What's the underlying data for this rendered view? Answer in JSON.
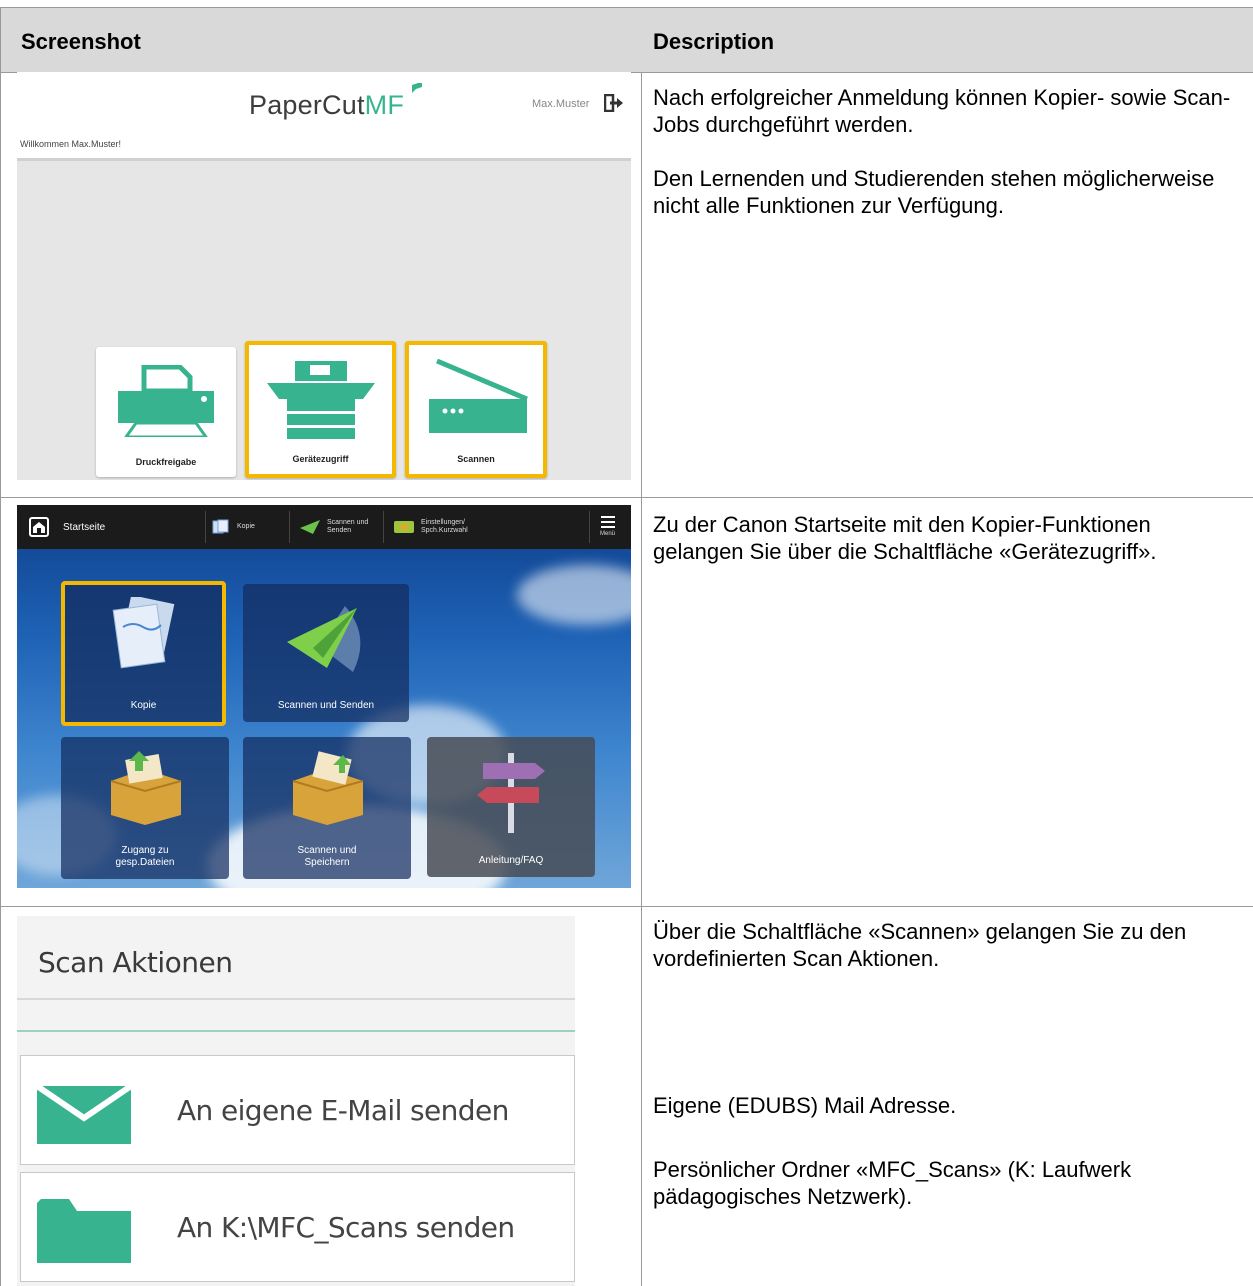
{
  "table": {
    "headers": {
      "screenshot": "Screenshot",
      "description": "Description"
    }
  },
  "row1": {
    "papercut": {
      "logo_main": "PaperCut",
      "logo_accent": "MF",
      "user": "Max.Muster",
      "welcome": "Willkommen Max.Muster!",
      "tiles": [
        {
          "label": "Druckfreigabe",
          "highlighted": false,
          "icon": "printer-icon"
        },
        {
          "label": "Gerätezugriff",
          "highlighted": true,
          "icon": "copier-icon"
        },
        {
          "label": "Scannen",
          "highlighted": true,
          "icon": "scanner-icon"
        }
      ],
      "accent_color": "#37b48f",
      "highlight_color": "#f5b800"
    },
    "description": [
      "Nach erfolgreicher Anmeldung können Kopier- sowie Scan-Jobs durchgeführt werden.",
      "Den Lernenden und Studierenden stehen möglicherweise nicht alle Funktionen zur Verfügung."
    ]
  },
  "row2": {
    "canon": {
      "nav": {
        "home": "Startseite",
        "copy": "Kopie",
        "scan_send": "Scannen und Senden",
        "settings": "Einstellungen/ Spch.Kurzwahl",
        "menu": "Menü"
      },
      "tiles": [
        {
          "label": "Kopie",
          "highlighted": true
        },
        {
          "label": "Scannen und Senden",
          "highlighted": false
        },
        {
          "label": "Zugang zu gesp.Dateien",
          "highlighted": false
        },
        {
          "label": "Scannen und Speichern",
          "highlighted": false
        },
        {
          "label": "Anleitung/FAQ",
          "highlighted": false
        }
      ]
    },
    "description": "Zu der Canon Startseite mit den Kopier-Funktionen gelangen Sie über die Schaltfläche «Gerätezugriff»."
  },
  "row3": {
    "scan": {
      "title": "Scan Aktionen",
      "items": [
        {
          "label": "An eigene E-Mail senden",
          "icon": "envelope-icon"
        },
        {
          "label": "An K:\\MFC_Scans senden",
          "icon": "folder-icon"
        }
      ]
    },
    "description": [
      "Über die Schaltfläche «Scannen» gelangen Sie zu den vordefinierten Scan Aktionen.",
      "Eigene (EDUBS) Mail Adresse.",
      "Persönlicher Ordner «MFC_Scans» (K: Laufwerk pädagogisches Netzwerk)."
    ]
  }
}
